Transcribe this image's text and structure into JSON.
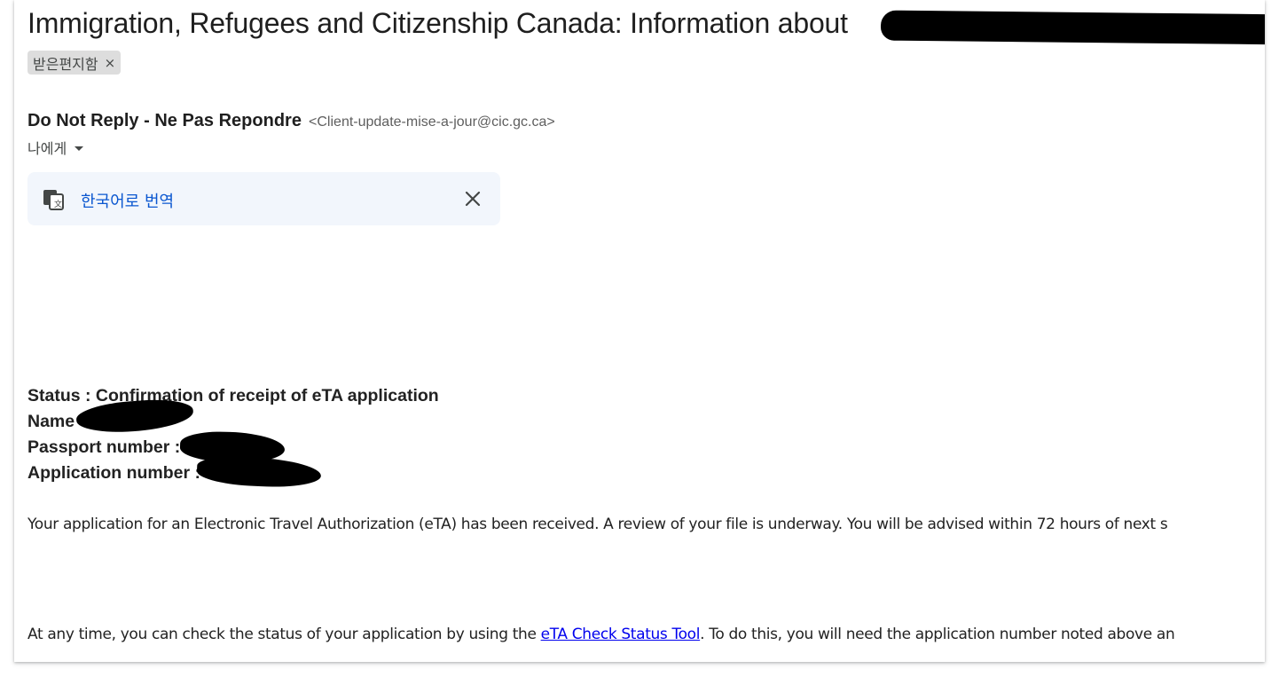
{
  "email": {
    "subject": "Immigration, Refugees and Citizenship Canada: Information about",
    "labels": [
      {
        "name": "받은편지함",
        "remove_glyph": "×"
      }
    ],
    "sender": {
      "name": "Do Not Reply - Ne Pas Repondre",
      "email": "<Client-update-mise-a-jour@cic.gc.ca>"
    },
    "recipient_line": "나에게",
    "translate_banner": {
      "icon": "translate-icon",
      "link_text": "한국어로 번역",
      "close_icon": "close-icon",
      "background": "#f2f6fc",
      "link_color": "#0b57d0"
    },
    "body": {
      "status": "Status : Confirmation of receipt of eTA application",
      "name_label": "Name",
      "passport_label": "Passport number :",
      "application_label": "Application number :",
      "paragraph1": "Your application for an Electronic Travel Authorization (eTA) has been received. A review of your file is underway. You will be advised within 72 hours of next s",
      "paragraph2_before": "At any time, you can check the status of your application by using the ",
      "paragraph2_link": "eTA Check Status Tool",
      "paragraph2_after": ". To do this, you will need the application number noted above an"
    }
  }
}
